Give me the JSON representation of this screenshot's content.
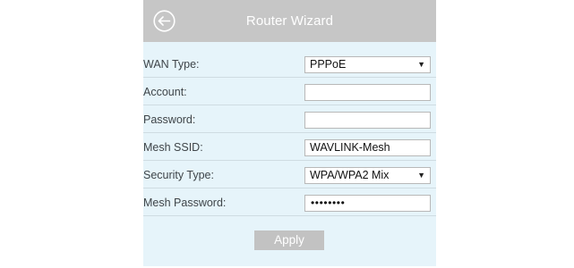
{
  "header": {
    "title": "Router Wizard",
    "back_icon": "back-arrow-circle-icon"
  },
  "form": {
    "wan_type": {
      "label": "WAN Type:",
      "value": "PPPoE",
      "arrow": "▼"
    },
    "account": {
      "label": "Account:",
      "value": ""
    },
    "password": {
      "label": "Password:",
      "value": ""
    },
    "mesh_ssid": {
      "label": "Mesh SSID:",
      "value": "WAVLINK-Mesh"
    },
    "security_type": {
      "label": "Security Type:",
      "value": "WPA/WPA2 Mix",
      "arrow": "▼"
    },
    "mesh_password": {
      "label": "Mesh Password:",
      "masked": "••••••••"
    }
  },
  "actions": {
    "apply_label": "Apply"
  },
  "colors": {
    "panel_bg": "#e6f4fa",
    "header_bg": "#c6c6c6",
    "button_bg": "#c2c2c2",
    "label_text": "#3f4549"
  }
}
